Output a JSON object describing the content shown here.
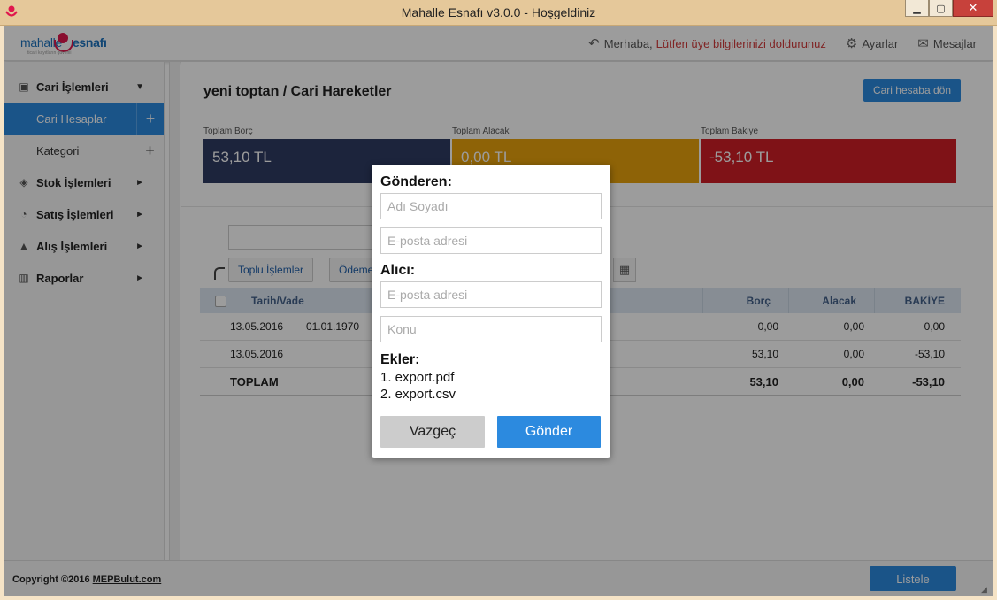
{
  "window": {
    "title": "Mahalle Esnafı v3.0.0 - Hoşgeldiniz",
    "minimize": "▁",
    "maximize": "▢",
    "close": "✕"
  },
  "header": {
    "logo_text_a": "mahalle",
    "logo_text_b": "esnafı",
    "logo_tagline": "ticari kayıtların güvenli",
    "greeting": "Merhaba,",
    "profile_hint": "Lütfen üye bilgilerinizi doldurunuz",
    "settings_label": "Ayarlar",
    "messages_label": "Mesajlar"
  },
  "sidebar": {
    "items": [
      {
        "label": "Cari İşlemleri",
        "icon": "id-card-icon",
        "arrow": "▼"
      },
      {
        "label": "Cari Hesaplar",
        "plus": "+"
      },
      {
        "label": "Kategori",
        "plus": "+"
      },
      {
        "label": "Stok İşlemleri",
        "icon": "box-icon",
        "arrow": "►"
      },
      {
        "label": "Satış İşlemleri",
        "icon": "gauge-icon",
        "arrow": "►"
      },
      {
        "label": "Alış İşlemleri",
        "icon": "basket-icon",
        "arrow": "►"
      },
      {
        "label": "Raporlar",
        "icon": "bar-chart-icon",
        "arrow": "►"
      }
    ]
  },
  "main": {
    "title": "yeni toptan / Cari Hareketler",
    "back_button": "Cari hesaba dön",
    "totals": [
      {
        "label": "Toplam Borç",
        "value": "53,10 TL",
        "color": "#2e3b63"
      },
      {
        "label": "Toplam Alacak",
        "value": "0,00 TL",
        "color": "#e8a20c"
      },
      {
        "label": "Toplam Bakiye",
        "value": "-53,10 TL",
        "color": "#d01e26"
      }
    ],
    "toolbar": {
      "bulk_label": "Toplu İşlemler",
      "payment_label": "Ödeme"
    },
    "table": {
      "headers": {
        "date": "Tarih/Vade",
        "debt": "Borç",
        "credit": "Alacak",
        "balance": "BAKİYE"
      },
      "rows": [
        {
          "date": "13.05.2016",
          "vade": "01.01.1970",
          "debt": "0,00",
          "credit": "0,00",
          "balance": "0,00"
        },
        {
          "date": "13.05.2016",
          "vade": "",
          "debt": "53,10",
          "credit": "0,00",
          "balance": "-53,10"
        }
      ],
      "total": {
        "label": "TOPLAM",
        "debt": "53,10",
        "credit": "0,00",
        "balance": "-53,10"
      }
    }
  },
  "footer": {
    "copyright_prefix": "Copyright ©2016 ",
    "copyright_link": "MEPBulut.com",
    "list_button": "Listele"
  },
  "modal": {
    "sender_heading": "Gönderen:",
    "sender_name_placeholder": "Adı Soyadı",
    "sender_email_placeholder": "E-posta adresi",
    "recipient_heading": "Alıcı:",
    "recipient_email_placeholder": "E-posta adresi",
    "subject_placeholder": "Konu",
    "attachments_heading": "Ekler:",
    "attachments": [
      "1. export.pdf",
      "2. export.csv"
    ],
    "cancel_label": "Vazgeç",
    "send_label": "Gönder"
  }
}
